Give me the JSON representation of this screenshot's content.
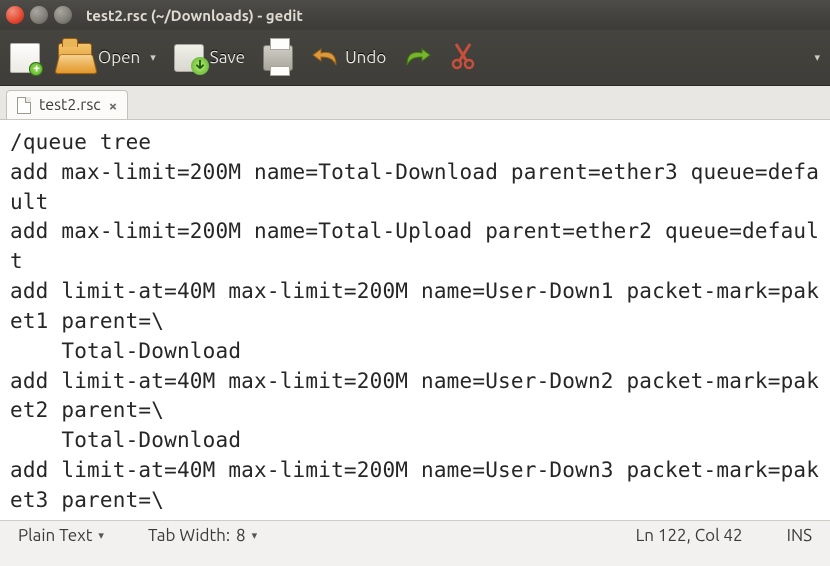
{
  "window": {
    "title": "test2.rsc (~/Downloads) - gedit"
  },
  "toolbar": {
    "open_label": "Open",
    "save_label": "Save",
    "undo_label": "Undo"
  },
  "tabs": [
    {
      "label": "test2.rsc"
    }
  ],
  "editor": {
    "content": "/queue tree\nadd max-limit=200M name=Total-Download parent=ether3 queue=default\nadd max-limit=200M name=Total-Upload parent=ether2 queue=default\nadd limit-at=40M max-limit=200M name=User-Down1 packet-mark=paket1 parent=\\\n    Total-Download\nadd limit-at=40M max-limit=200M name=User-Down2 packet-mark=paket2 parent=\\\n    Total-Download\nadd limit-at=40M max-limit=200M name=User-Down3 packet-mark=paket3 parent=\\"
  },
  "statusbar": {
    "syntax": "Plain Text",
    "tabwidth_label": "Tab Width:",
    "tabwidth_value": "8",
    "position": "Ln 122, Col 42",
    "insert_mode": "INS"
  },
  "icons": {
    "dropdown": "▾"
  }
}
